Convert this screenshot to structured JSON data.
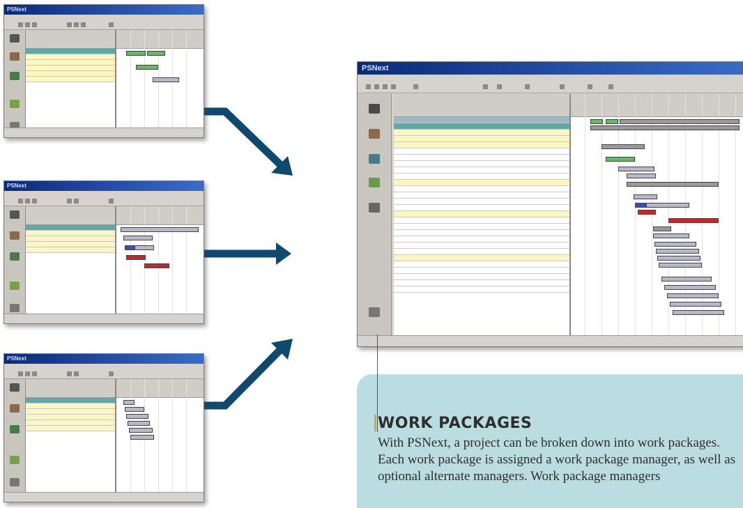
{
  "small_window": {
    "logo": "PSNext"
  },
  "main_window": {
    "logo": "PSNext"
  },
  "info_panel": {
    "title": "WORK PACKAGES",
    "body": "With PSNext, a project can be broken down into work packages. Each work package is assigned a work package manager, as well as optional alternate managers. Work package managers"
  },
  "colors": {
    "arrow": "#0f4a6e",
    "panel_bg": "#b9dde0",
    "accent": "#e5a13a",
    "row_teal": "#5fa8a8",
    "row_yellow": "#fbf6c2",
    "bar_green": "#6db36b",
    "bar_blue": "#3b4fa8",
    "bar_red": "#c0282a",
    "bar_grey": "#b8b8c8"
  }
}
